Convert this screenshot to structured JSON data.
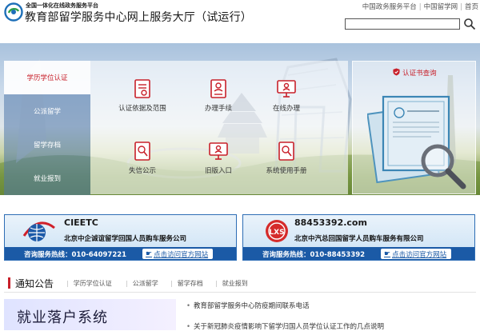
{
  "header": {
    "site_sub": "全国一体化在线政务服务平台",
    "site_title": "教育部留学服务中心网上服务大厅（试运行）",
    "links": [
      "中国政务服务平台",
      "中国留学网",
      "首页"
    ],
    "link_sep": "|"
  },
  "search": {
    "value": "",
    "placeholder": ""
  },
  "side_nav": {
    "items": [
      {
        "label": "学历学位认证",
        "active": true
      },
      {
        "label": "公派留学",
        "active": false
      },
      {
        "label": "留学存档",
        "active": false
      },
      {
        "label": "就业报到",
        "active": false
      }
    ]
  },
  "services": [
    {
      "label": "认证依据及范围",
      "icon": "certificate-doc-icon"
    },
    {
      "label": "办理手续",
      "icon": "id-card-icon"
    },
    {
      "label": "在线办理",
      "icon": "monitor-user-icon"
    },
    {
      "label": "失信公示",
      "icon": "search-doc-icon"
    },
    {
      "label": "旧版入口",
      "icon": "monitor-user-icon"
    },
    {
      "label": "系统使用手册",
      "icon": "search-doc-icon"
    }
  ],
  "cert_lookup": {
    "title": "认证书查询",
    "icon": "shield-icon"
  },
  "ads": [
    {
      "brand": "CIEETC",
      "company": "北京中企诚谊留学回国人员购车服务公司",
      "hotline": "咨询服务热线：010-64097221",
      "visit": "点击访问官方网站"
    },
    {
      "brand": "88453392.com",
      "company": "北京中汽总回国留学人员购车服务有限公司",
      "hotline": "咨询服务热线：010-88453392",
      "visit": "点击访问官方网站"
    }
  ],
  "notice": {
    "title": "通知公告",
    "tabs": [
      "学历学位认证",
      "公派留学",
      "留学存档",
      "就业报到"
    ]
  },
  "promo": {
    "text": "就业落户系统"
  },
  "news": [
    "教育部留学服务中心防疫期间联系电话",
    "关于新冠肺炎疫情影响下留学归国人员学位认证工作的几点说明"
  ],
  "colors": {
    "accent_red": "#c8202a",
    "brand_blue": "#1b5aa6"
  }
}
